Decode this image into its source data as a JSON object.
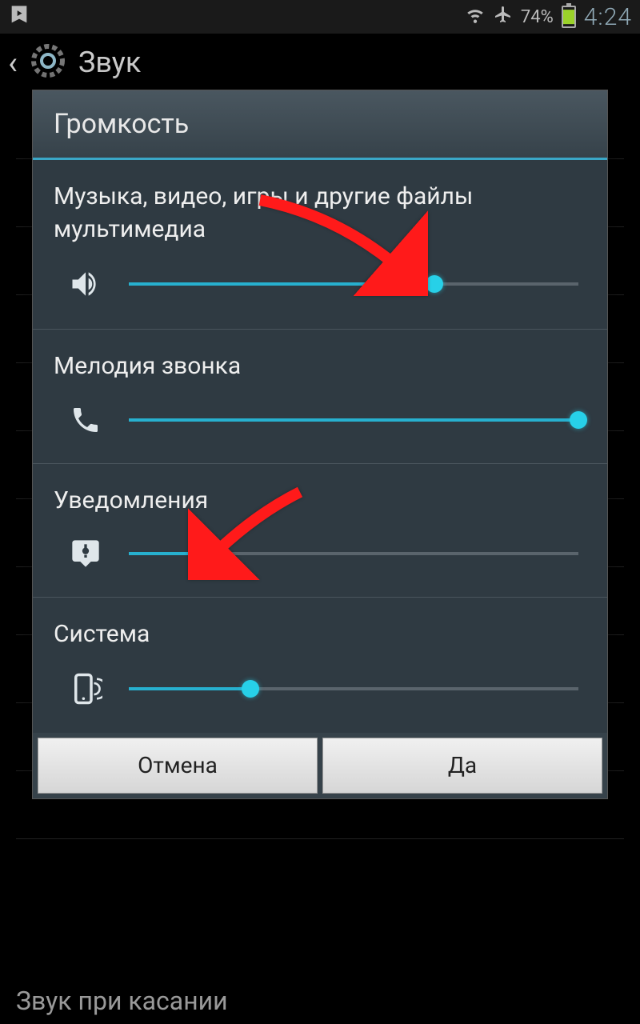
{
  "statusbar": {
    "battery_pct": "74%",
    "clock": "4:24"
  },
  "background": {
    "title": "Звук",
    "bottom_item": "Звук при касании"
  },
  "dialog": {
    "title": "Громкость",
    "sections": [
      {
        "label": "Музыка, видео, игры и другие файлы мультимедиа",
        "icon": "speaker",
        "value": 68
      },
      {
        "label": "Мелодия звонка",
        "icon": "phone",
        "value": 100
      },
      {
        "label": "Уведомления",
        "icon": "notification",
        "value": 17
      },
      {
        "label": "Система",
        "icon": "device",
        "value": 27
      }
    ],
    "cancel": "Отмена",
    "ok": "Да"
  },
  "colors": {
    "accent": "#27b0cf",
    "thumb": "#27d0e8",
    "dialog_bg": "#2f3a42"
  }
}
